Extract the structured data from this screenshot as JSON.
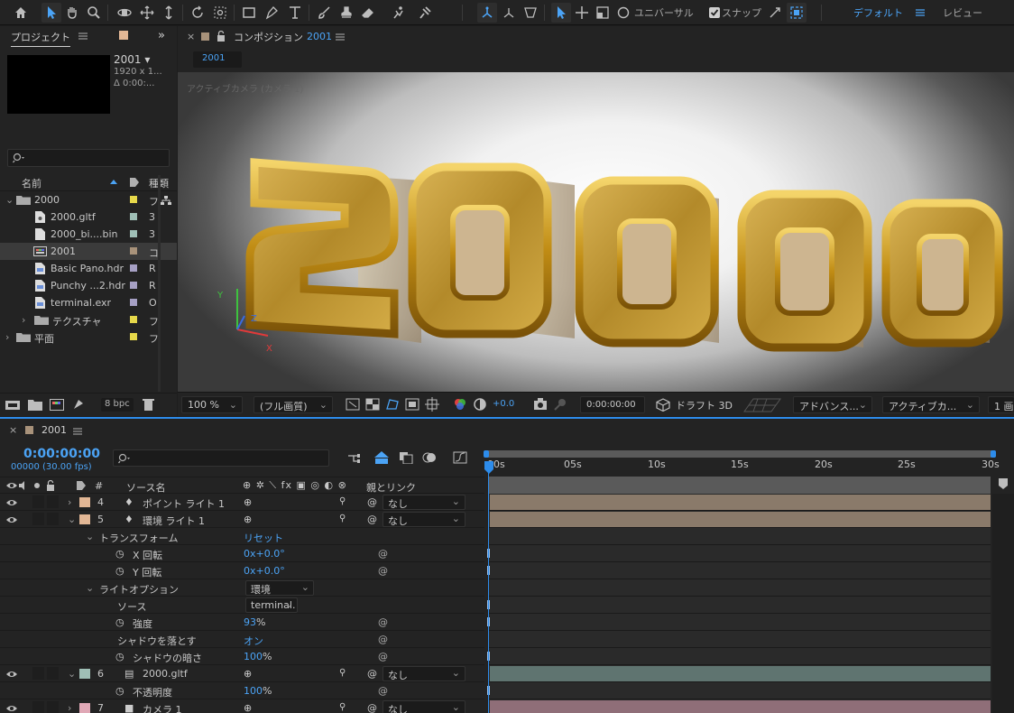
{
  "toolbar": {
    "universal_label": "ユニバーサル",
    "snap_label": "スナップ",
    "workspace_default": "デフォルト",
    "workspace_review": "レビュー"
  },
  "project": {
    "tab_label": "プロジェクト",
    "preview_name": "2001 ▾",
    "preview_res": "1920 x 1...",
    "preview_dur": "Δ 0:00:...",
    "search_placeholder": "",
    "col_name": "名前",
    "col_type": "種類",
    "items": [
      {
        "name": "2000",
        "type": "フ",
        "color": "#e6d84a"
      },
      {
        "name": "2000.gltf",
        "type": "3",
        "color": "#9fbfb6"
      },
      {
        "name": "2000_bi....bin",
        "type": "3",
        "color": "#9fbfb6"
      },
      {
        "name": "2001",
        "type": "コ",
        "color": "#a8927a"
      },
      {
        "name": "Basic Pano.hdr",
        "type": "R",
        "color": "#a6a0c4"
      },
      {
        "name": "Punchy ...2.hdr",
        "type": "R",
        "color": "#a6a0c4"
      },
      {
        "name": "terminal.exr",
        "type": "O",
        "color": "#a6a0c4"
      },
      {
        "name": "テクスチャ",
        "type": "フ",
        "color": "#e6d84a"
      },
      {
        "name": "平面",
        "type": "フ",
        "color": "#e6d84a"
      }
    ],
    "bpc": "8 bpc"
  },
  "composition": {
    "tab_label": "コンポジション",
    "tab_name": "2001",
    "subtab": "2001",
    "camera_label": "アクティブカメラ (カメラ 1)",
    "render_text": "20000",
    "zoom": "100 %",
    "quality": "(フル画質)",
    "exposure": "+0.0",
    "timecode": "0:00:00:00",
    "renderer": "ドラフト 3D",
    "advanced": "アドバンス...",
    "view": "アクティブカ...",
    "view_count": "1 画"
  },
  "timeline": {
    "tab_label": "2001",
    "timecode": "0:00:00:00",
    "frames": "00000 (30.00 fps)",
    "col_source": "ソース名",
    "col_parent": "親とリンク",
    "ruler": [
      "00s",
      "05s",
      "10s",
      "15s",
      "20s",
      "25s",
      "30s"
    ],
    "rows": [
      {
        "kind": "layer",
        "num": "4",
        "name": "ポイント ライト 1",
        "parent": "なし",
        "color": "#e2b795"
      },
      {
        "kind": "layer",
        "num": "5",
        "name": "環境 ライト 1",
        "parent": "なし",
        "color": "#e2b795"
      },
      {
        "kind": "group",
        "name": "トランスフォーム",
        "value": "リセット"
      },
      {
        "kind": "prop",
        "name": "X 回転",
        "value": "0x+0.0°"
      },
      {
        "kind": "prop",
        "name": "Y 回転",
        "value": "0x+0.0°"
      },
      {
        "kind": "group",
        "name": "ライトオプション",
        "value": "環境"
      },
      {
        "kind": "prop2",
        "name": "ソース",
        "value": "terminal."
      },
      {
        "kind": "prop",
        "name": "強度",
        "value": "93",
        "unit": "%"
      },
      {
        "kind": "prop2",
        "name": "シャドウを落とす",
        "value": "オン"
      },
      {
        "kind": "prop",
        "name": "シャドウの暗さ",
        "value": "100",
        "unit": "%"
      },
      {
        "kind": "layer",
        "num": "6",
        "name": "2000.gltf",
        "parent": "なし",
        "color": "#9fbfb6"
      },
      {
        "kind": "prop",
        "name": "不透明度",
        "value": "100",
        "unit": "%"
      },
      {
        "kind": "layer",
        "num": "7",
        "name": "カメラ 1",
        "parent": "なし",
        "color": "#e0a8b6"
      }
    ]
  },
  "colors": {
    "accent": "#2d8ceb",
    "gold": "#c99a24",
    "light_bar": "#8a7a6a",
    "gltf_bar": "#5f7470",
    "camera_bar": "#8f6e78"
  }
}
